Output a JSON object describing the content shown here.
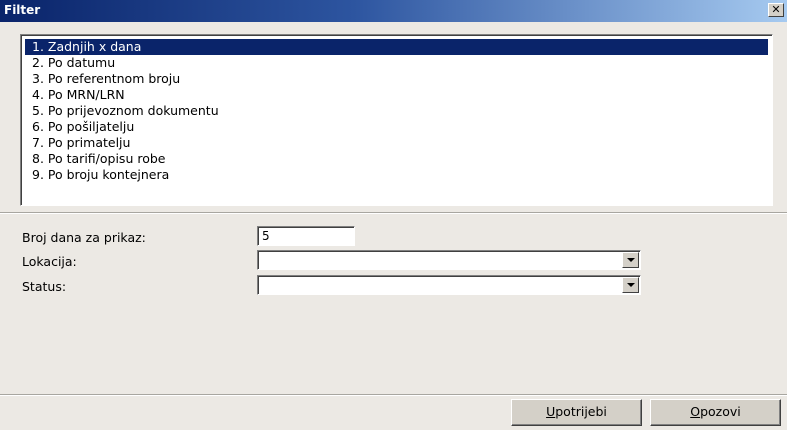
{
  "window": {
    "title": "Filter",
    "close_glyph": "✕"
  },
  "list": {
    "items": [
      "1. Zadnjih x dana",
      "2. Po datumu",
      "3. Po referentnom broju",
      "4. Po MRN/LRN",
      "5. Po prijevoznom dokumentu",
      "6. Po pošiljatelju",
      "7. Po primatelju",
      "8. Po tarifi/opisu robe",
      "9. Po broju kontejnera"
    ],
    "selected_index": 0
  },
  "form": {
    "days_label": "Broj dana za prikaz:",
    "days_value": "5",
    "location_label": "Lokacija:",
    "location_value": "",
    "status_label": "Status:",
    "status_value": ""
  },
  "buttons": {
    "apply_mnemonic": "U",
    "apply_rest": "potrijebi",
    "cancel_mnemonic": "O",
    "cancel_rest": "pozovi"
  },
  "colors": {
    "selection": "#0a246a",
    "dialog_bg": "#ece9e4"
  }
}
